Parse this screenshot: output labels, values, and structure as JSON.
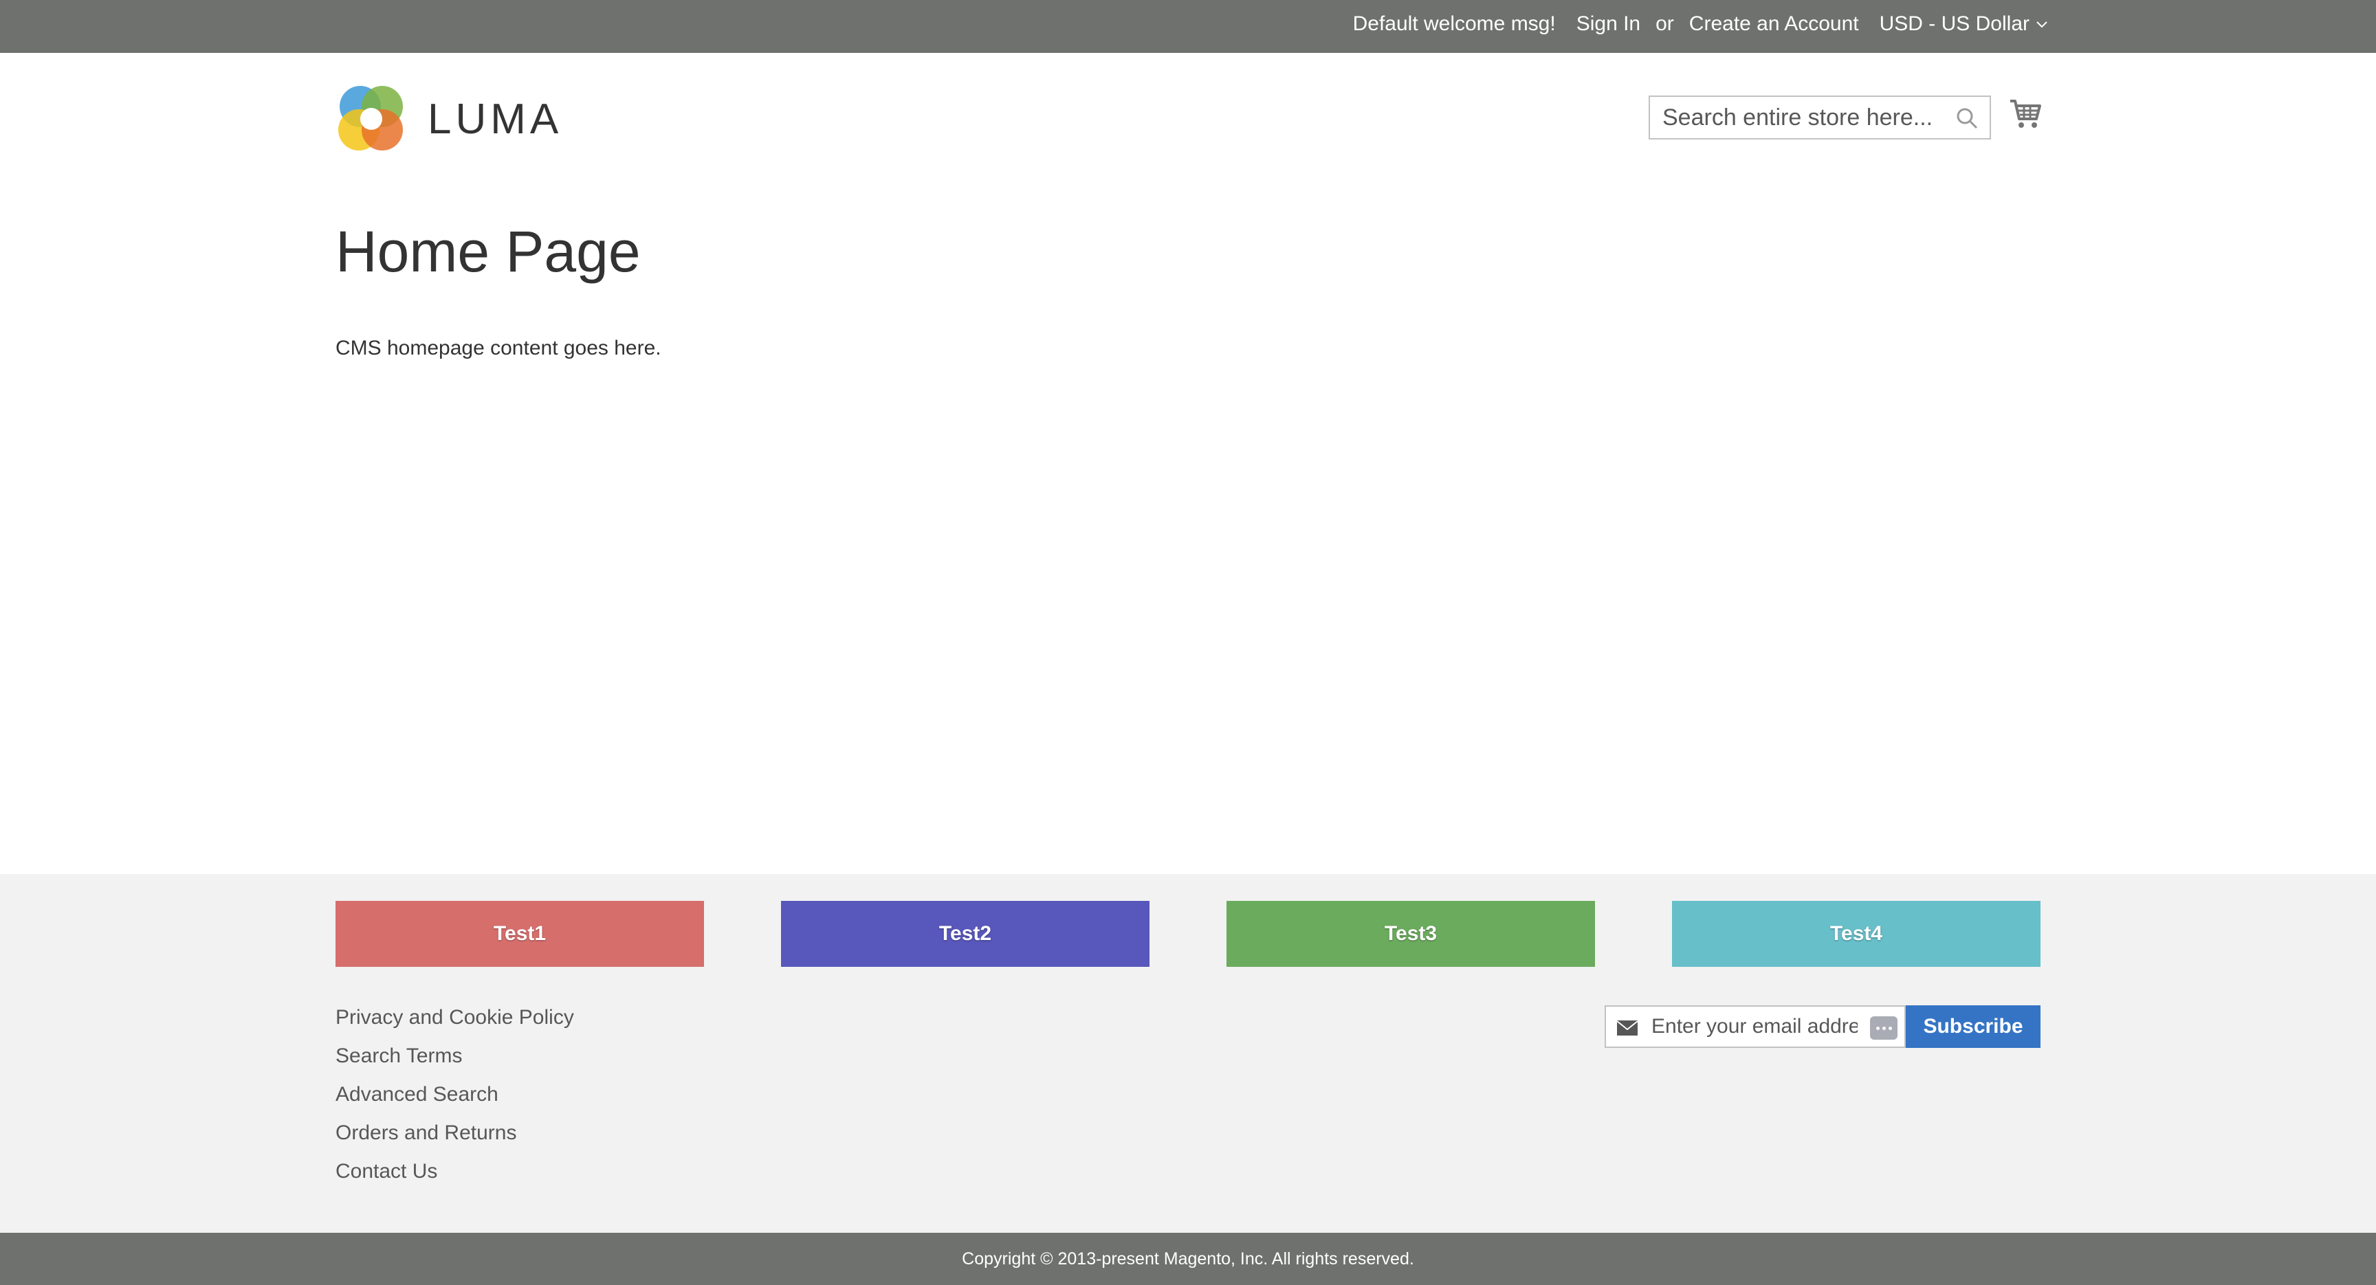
{
  "panel": {
    "welcome": "Default welcome msg!",
    "sign_in": "Sign In",
    "or": "or",
    "create_account": "Create an Account",
    "currency": "USD - US Dollar"
  },
  "header": {
    "logo_text": "LUMA",
    "search_placeholder": "Search entire store here...",
    "cart_icon": "cart-icon"
  },
  "main": {
    "title": "Home Page",
    "content": "CMS homepage content goes here."
  },
  "footer": {
    "test_buttons": [
      {
        "label": "Test1",
        "color": "#d66e6c"
      },
      {
        "label": "Test2",
        "color": "#5857bb"
      },
      {
        "label": "Test3",
        "color": "#6bab5e"
      },
      {
        "label": "Test4",
        "color": "#67bfca"
      }
    ],
    "links": [
      "Privacy and Cookie Policy",
      "Search Terms",
      "Advanced Search",
      "Orders and Returns",
      "Contact Us"
    ],
    "newsletter": {
      "placeholder": "Enter your email address",
      "subscribe_label": "Subscribe"
    },
    "copyright": "Copyright © 2013-present Magento, Inc. All rights reserved."
  },
  "colors": {
    "panel_bg": "#6e716e",
    "footer_bg": "#f2f2f2",
    "subscribe_bg": "#3574c5"
  }
}
